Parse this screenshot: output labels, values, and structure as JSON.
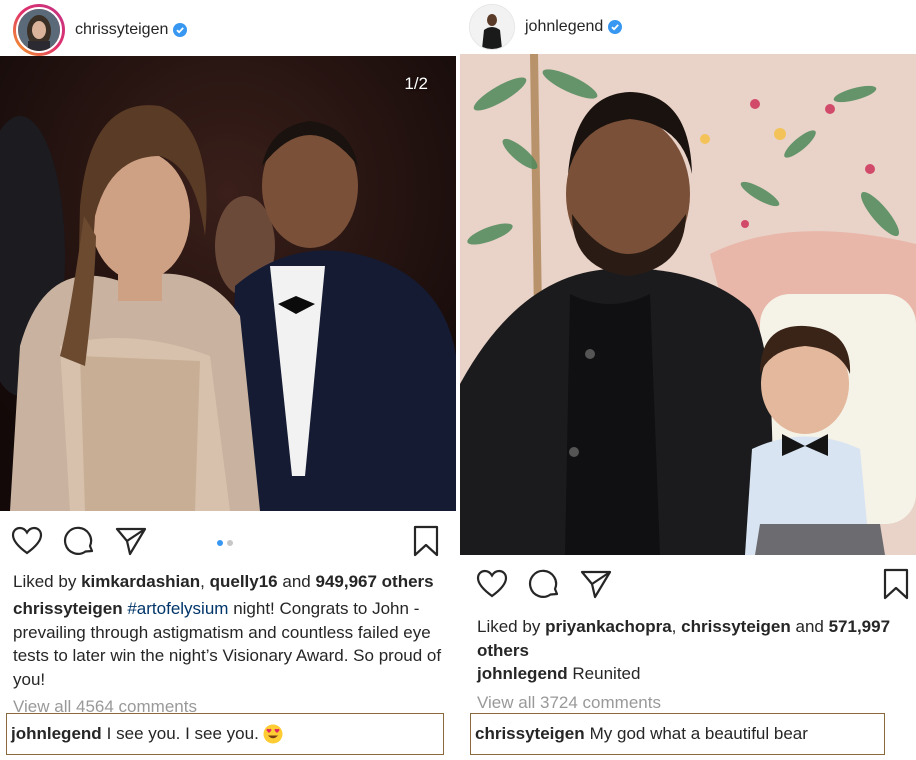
{
  "left_post": {
    "username": "chrissyteigen",
    "verified": true,
    "carousel_counter": "1/2",
    "likes": {
      "prefix": "Liked by",
      "user1": "kimkardashian",
      "sep": ",",
      "user2": "quelly16",
      "and": "and",
      "count": "949,967 others"
    },
    "caption": {
      "username": "chrissyteigen",
      "hashtag": "#artofelysium",
      "text": "night! Congrats to John - prevailing through astigmatism and countless failed eye tests to later win the night’s Visionary Award. So proud of you!"
    },
    "view_all_comments": "View all 4564 comments",
    "highlight_comment": {
      "username": "johnlegend",
      "text": "I see you. I see you.",
      "emoji": "heart-eyes-emoji"
    }
  },
  "right_post": {
    "username": "johnlegend",
    "verified": true,
    "likes": {
      "prefix": "Liked by",
      "user1": "priyankachopra",
      "sep": ",",
      "user2": "chrissyteigen",
      "and": "and",
      "count": "571,997 others"
    },
    "caption": {
      "username": "johnlegend",
      "text": "Reunited"
    },
    "view_all_comments": "View all 3724 comments",
    "highlight_comment": {
      "username": "chrissyteigen",
      "text": "My god what a beautiful bear"
    }
  },
  "icons": [
    "heart-icon",
    "comment-icon",
    "share-icon",
    "bookmark-icon",
    "verified-badge-icon"
  ],
  "colors": {
    "verified_blue": "#3897f0",
    "hashtag": "#003569",
    "muted_text": "#999999",
    "highlight_border": "#8a6a3c",
    "carousel_dot_active": "#3897f0",
    "carousel_dot_inactive": "#c7c7c7",
    "story_ring": "#e1306c"
  }
}
